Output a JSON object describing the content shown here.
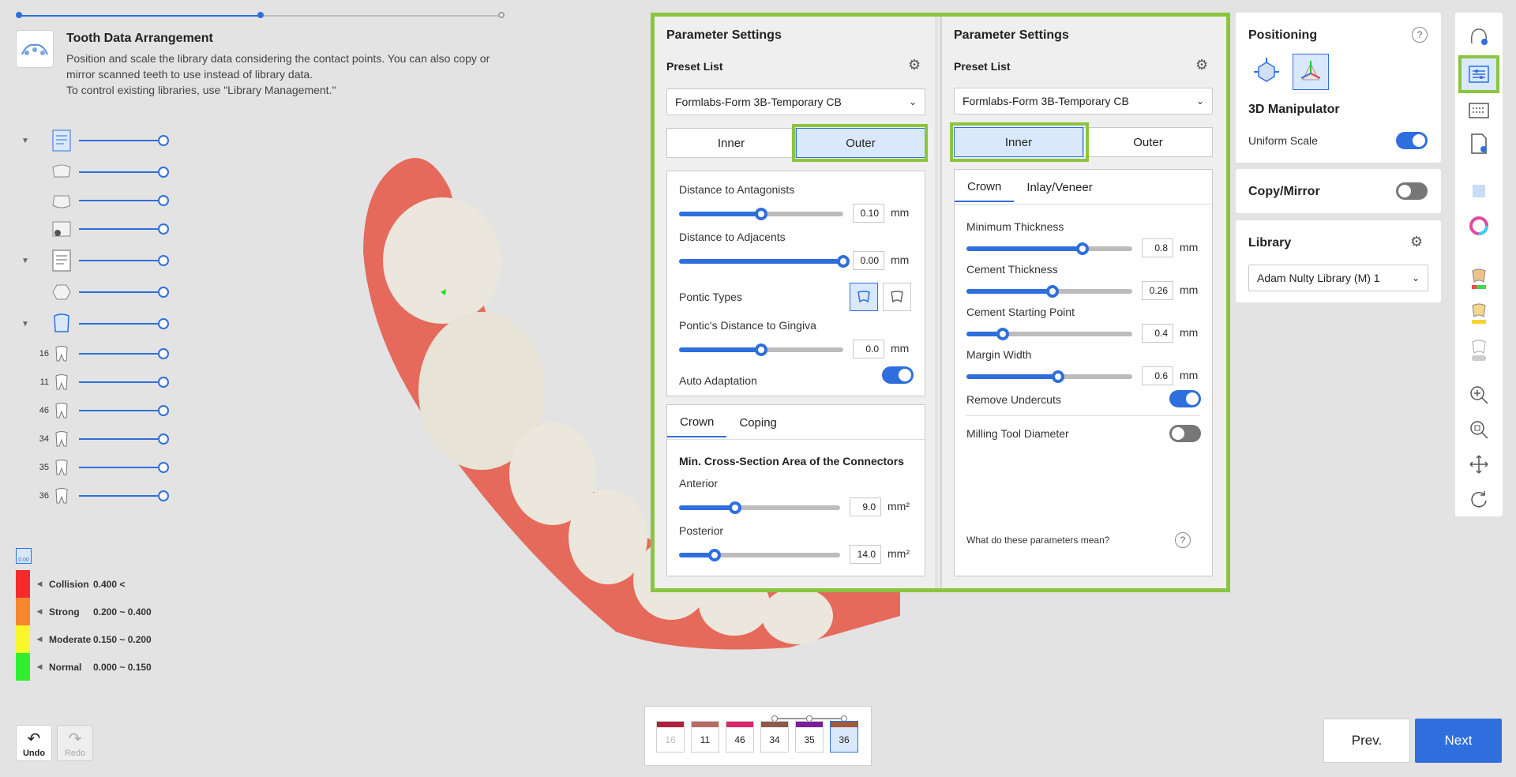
{
  "header": {
    "title": "Tooth Data Arrangement",
    "description_1": "Position and scale the library data considering the contact points. You can also copy or mirror scanned teeth to use instead of library data.",
    "description_2": "To control existing libraries, use \"Library Management.\""
  },
  "tree": {
    "tooth_numbers": [
      "16",
      "11",
      "46",
      "34",
      "35",
      "36"
    ]
  },
  "legend": {
    "items": [
      {
        "name": "Collision",
        "range": "0.400 <",
        "color": "#f52b2b"
      },
      {
        "name": "Strong",
        "range": "0.200 ~ 0.400",
        "color": "#f7872e"
      },
      {
        "name": "Moderate",
        "range": "0.150 ~ 0.200",
        "color": "#f7f72c"
      },
      {
        "name": "Normal",
        "range": "0.000 ~ 0.150",
        "color": "#2ef02e"
      }
    ],
    "badge": "0.00"
  },
  "undo": {
    "label": "Undo"
  },
  "redo": {
    "label": "Redo"
  },
  "left_panel": {
    "title": "Parameter Settings",
    "preset_label": "Preset List",
    "preset_value": "Formlabs-Form 3B-Temporary CB",
    "seg": [
      "Inner",
      "Outer"
    ],
    "selected_seg": "Outer",
    "params": [
      {
        "label": "Distance to Antagonists",
        "value": "0.10",
        "unit": "mm",
        "level": 0.5
      },
      {
        "label": "Distance to Adjacents",
        "value": "0.00",
        "unit": "mm",
        "level": 1.0
      }
    ],
    "pontic_types_label": "Pontic Types",
    "pontic_distance": {
      "label": "Pontic's Distance to Gingiva",
      "value": "0.0",
      "unit": "mm",
      "level": 0.5
    },
    "auto_adaptation": {
      "label": "Auto Adaptation",
      "on": true
    },
    "tabs": [
      "Crown",
      "Coping"
    ],
    "connectors_title": "Min. Cross-Section Area of the Connectors",
    "anterior": {
      "label": "Anterior",
      "value": "9.0",
      "unit": "mm²",
      "level": 0.35
    },
    "posterior": {
      "label": "Posterior",
      "value": "14.0",
      "unit": "mm²",
      "level": 0.22
    }
  },
  "right_panel": {
    "title": "Parameter Settings",
    "preset_label": "Preset List",
    "preset_value": "Formlabs-Form 3B-Temporary CB",
    "seg": [
      "Inner",
      "Outer"
    ],
    "selected_seg": "Inner",
    "tabs": [
      "Crown",
      "Inlay/Veneer"
    ],
    "params": [
      {
        "label": "Minimum Thickness",
        "value": "0.8",
        "unit": "mm",
        "level": 0.7
      },
      {
        "label": "Cement Thickness",
        "value": "0.26",
        "unit": "mm",
        "level": 0.52
      },
      {
        "label": "Cement Starting Point",
        "value": "0.4",
        "unit": "mm",
        "level": 0.22
      },
      {
        "label": "Margin Width",
        "value": "0.6",
        "unit": "mm",
        "level": 0.55
      }
    ],
    "remove_undercuts": {
      "label": "Remove Undercuts",
      "on": true
    },
    "milling_tool": {
      "label": "Milling Tool Diameter",
      "on": false
    },
    "help_text": "What do these parameters mean?"
  },
  "positioning": {
    "title": "Positioning",
    "manipulator_title": "3D Manipulator",
    "uniform_scale": {
      "label": "Uniform Scale",
      "on": true
    }
  },
  "copy_mirror": {
    "label": "Copy/Mirror",
    "on": false
  },
  "library": {
    "title": "Library",
    "value": "Adam Nulty Library (M) 1"
  },
  "tooth_selector": {
    "teeth": [
      {
        "num": "16",
        "color": "#b0203c",
        "disabled": true,
        "selected": false
      },
      {
        "num": "11",
        "color": "#b86a64",
        "disabled": false,
        "selected": false
      },
      {
        "num": "46",
        "color": "#d9266e",
        "disabled": false,
        "selected": false
      },
      {
        "num": "34",
        "color": "#8c5a4a",
        "disabled": false,
        "selected": false
      },
      {
        "num": "35",
        "color": "#7a1f9a",
        "disabled": false,
        "selected": false
      },
      {
        "num": "36",
        "color": "#a05a3c",
        "disabled": false,
        "selected": true
      }
    ]
  },
  "nav": {
    "prev": "Prev.",
    "next": "Next"
  },
  "colors": {
    "accent": "#2f6fdd",
    "highlight": "#8bc53f",
    "gum": "#e56a5c",
    "tooth": "#ebe7dc"
  }
}
